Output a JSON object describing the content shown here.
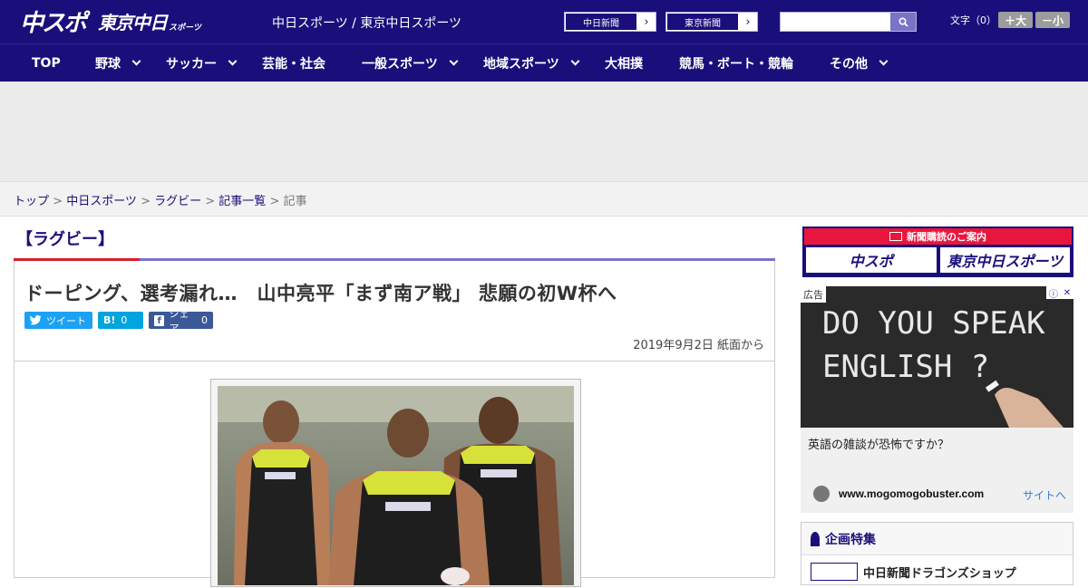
{
  "header": {
    "logo_main": "中スポ",
    "logo_tokyo": "東京中日",
    "logo_small": "スポーツ",
    "site_links": "中日スポーツ / 東京中日スポーツ",
    "paper1": "中日新聞",
    "paper2": "東京新聞",
    "font_size_label": "文字（0）",
    "font_bigger": "＋大",
    "font_smaller": "－小"
  },
  "nav": {
    "items": [
      {
        "label": "TOP",
        "has_menu": false
      },
      {
        "label": "野球",
        "has_menu": true
      },
      {
        "label": "サッカー",
        "has_menu": true
      },
      {
        "label": "芸能・社会",
        "has_menu": false
      },
      {
        "label": "一般スポーツ",
        "has_menu": true
      },
      {
        "label": "地域スポーツ",
        "has_menu": true
      },
      {
        "label": "大相撲",
        "has_menu": false
      },
      {
        "label": "競馬・ボート・競輪",
        "has_menu": false
      },
      {
        "label": "その他",
        "has_menu": true
      }
    ]
  },
  "breadcrumb": {
    "top": "トップ",
    "chunichi": "中日スポーツ",
    "rugby": "ラグビー",
    "list": "記事一覧",
    "current": "記事",
    "sep": " > "
  },
  "article": {
    "category": "【ラグビー】",
    "headline": "ドーピング、選考漏れ…　山中亮平「まず南ア戦」 悲願の初W杯へ",
    "tweet": "ツイート",
    "hatena": "B!",
    "hatena_count": "0",
    "share": "シェア",
    "share_count": "0",
    "date": "2019年9月2日 紙面から"
  },
  "sidebar": {
    "subscribe_header": "新聞購読のご案内",
    "sub_logo1": "中スポ",
    "sub_logo2": "東京中日スポーツ",
    "ad_badge": "広告",
    "ad_text_line1": "DO YOU SPEAK",
    "ad_text_line2": "ENGLISH ?",
    "ad_caption": "英語の雑談が恐怖ですか？",
    "ad_domain": "www.mogomogobuster.com",
    "ad_visit": "サイトへ",
    "special_title": "企画特集",
    "special_item": "中日新聞ドラゴンズショップ"
  },
  "colors": {
    "brand_navy": "#1a0f7a",
    "accent_red": "#d81e2a",
    "accent_purple": "#7a73c8",
    "subscribe_red": "#e8163d",
    "twitter": "#1da1f2",
    "hatena": "#00a4de",
    "facebook": "#3b5998"
  }
}
